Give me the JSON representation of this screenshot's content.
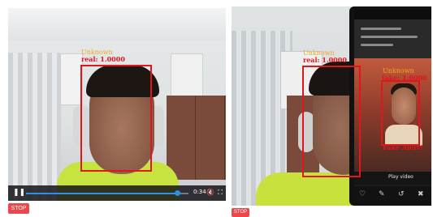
{
  "left_panel": {
    "detection": {
      "name_label": "Unknown",
      "score_label": "real: 1.0000"
    },
    "controls": {
      "time": "0:34",
      "progress_fraction": 0.93
    },
    "stop_label": "STOP"
  },
  "right_panel": {
    "detection_real": {
      "name_label": "Unknown",
      "score_label": "real: 1.0000"
    },
    "detection_fake": {
      "name_label": "Unknown",
      "score_label": "fake: 1.0000",
      "alert_label": "Fake Alert!"
    },
    "phone": {
      "play_label": "Play video"
    },
    "stop_label": "STOP"
  },
  "colors": {
    "bbox": "#e0161b",
    "name_label": "#f0a623",
    "stop_button": "#f0464b",
    "progress": "#2d8fe8"
  }
}
